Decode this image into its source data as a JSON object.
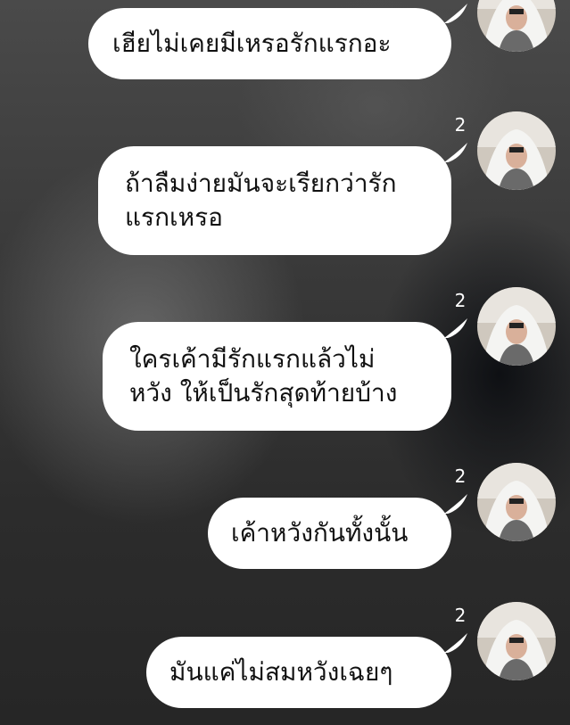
{
  "chat": {
    "messages": [
      {
        "text": "เฮียไม่เคยมีเหรอรักแรกอะ",
        "count": ""
      },
      {
        "text": "ถ้าลืมง่ายมันจะเรียกว่ารัก\nแรกเหรอ",
        "count": "2"
      },
      {
        "text": "ใครเค้ามีรักแรกแล้วไม่\nหวัง ให้เป็นรักสุดท้ายบ้าง",
        "count": "2"
      },
      {
        "text": "เค้าหวังกันทั้งนั้น",
        "count": "2"
      },
      {
        "text": "มันแค่ไม่สมหวังเฉยๆ",
        "count": "2"
      }
    ]
  },
  "colors": {
    "bubble": "#ffffff",
    "text": "#111111",
    "count": "#ffffff"
  }
}
